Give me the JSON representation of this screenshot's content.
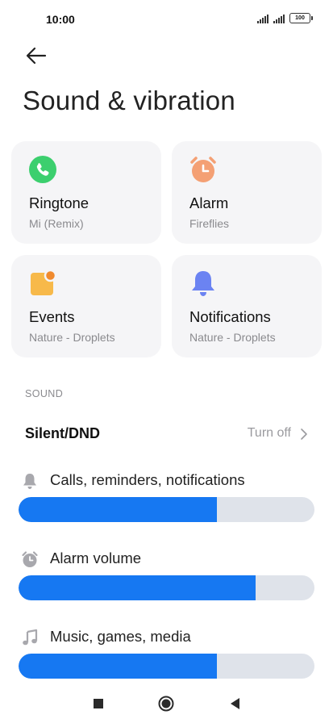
{
  "status_bar": {
    "time": "10:00",
    "battery": "100"
  },
  "header": {
    "title": "Sound & vibration"
  },
  "cards": [
    {
      "label": "Ringtone",
      "value": "Mi (Remix)",
      "icon": "phone-icon",
      "color": "#3ccf6e"
    },
    {
      "label": "Alarm",
      "value": "Fireflies",
      "icon": "alarm-clock-icon",
      "color": "#f4a074"
    },
    {
      "label": "Events",
      "value": "Nature - Droplets",
      "icon": "event-icon",
      "color": "#f7b94a"
    },
    {
      "label": "Notifications",
      "value": "Nature - Droplets",
      "icon": "bell-icon",
      "color": "#6b83f2"
    }
  ],
  "sound": {
    "section_title": "SOUND",
    "silent": {
      "label": "Silent/DND",
      "value": "Turn off"
    },
    "volumes": [
      {
        "label": "Calls, reminders, notifications",
        "icon": "bell-icon",
        "level": 0.67
      },
      {
        "label": "Alarm volume",
        "icon": "alarm-clock-icon",
        "level": 0.8
      },
      {
        "label": "Music, games, media",
        "icon": "music-note-icon",
        "level": 0.67
      }
    ]
  },
  "colors": {
    "accent": "#1678f2",
    "track": "#dfe3ea",
    "card_bg": "#f5f5f7"
  }
}
